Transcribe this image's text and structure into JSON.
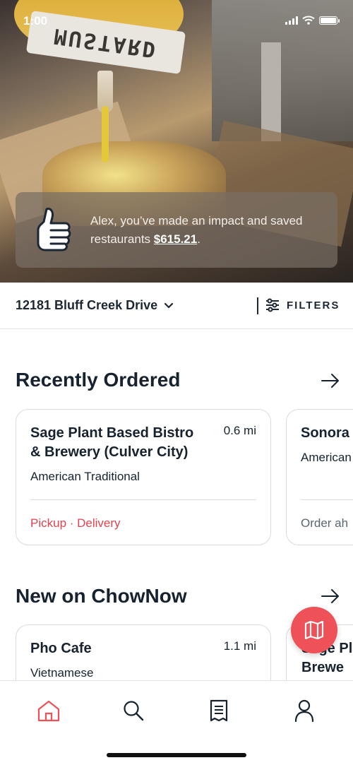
{
  "status_bar": {
    "time": "1:00"
  },
  "hero": {
    "bottle_label": "MUSTARD",
    "impact_message": "Alex, you’ve made an impact and saved restaurants ",
    "impact_amount": "$615.21",
    "impact_suffix": "."
  },
  "location": {
    "address": "12181 Bluff Creek Drive",
    "filters_label": "FILTERS"
  },
  "recently_ordered": {
    "title": "Recently Ordered",
    "cards": [
      {
        "name": "Sage Plant Based Bistro & Brewery (Culver City)",
        "distance": "0.6 mi",
        "cuisine": "American Traditional",
        "modes": "Pickup · Delivery"
      },
      {
        "name": "Sonora",
        "distance": "",
        "cuisine": "American",
        "modes": "Order ah"
      }
    ]
  },
  "new_on_chownow": {
    "title": "New on ChowNow",
    "cards": [
      {
        "name": "Pho Cafe",
        "distance": "1.1 mi",
        "cuisine": "Vietnamese"
      },
      {
        "name": "Sage Pla & Brewe",
        "distance": ""
      }
    ]
  },
  "bottom_nav": {
    "items": [
      "home-icon",
      "search-icon",
      "orders-icon",
      "account-icon"
    ]
  },
  "colors": {
    "accent": "#ee5157",
    "text": "#16232f",
    "border": "#d8dbdf"
  }
}
